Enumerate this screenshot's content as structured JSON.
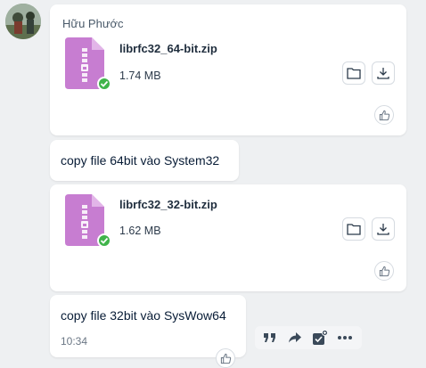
{
  "sender_name": "Hữu Phước",
  "messages": [
    {
      "type": "file",
      "file_name": "librfc32_64-bit.zip",
      "file_size": "1.74 MB"
    },
    {
      "type": "text",
      "text": "copy file 64bit vào System32"
    },
    {
      "type": "file",
      "file_name": "librfc32_32-bit.zip",
      "file_size": "1.62 MB"
    },
    {
      "type": "text",
      "text": "copy file 32bit vào SysWow64",
      "time": "10:34"
    }
  ],
  "icons": {
    "folder": "folder-icon",
    "download": "download-icon",
    "like": "thumbs-up-icon",
    "quote": "quote-icon",
    "forward": "forward-icon",
    "task": "task-icon",
    "more": "more-icon"
  },
  "colors": {
    "zip_icon": "#c77dd1",
    "check_badge": "#3fb44a",
    "background": "#eef0f2"
  }
}
